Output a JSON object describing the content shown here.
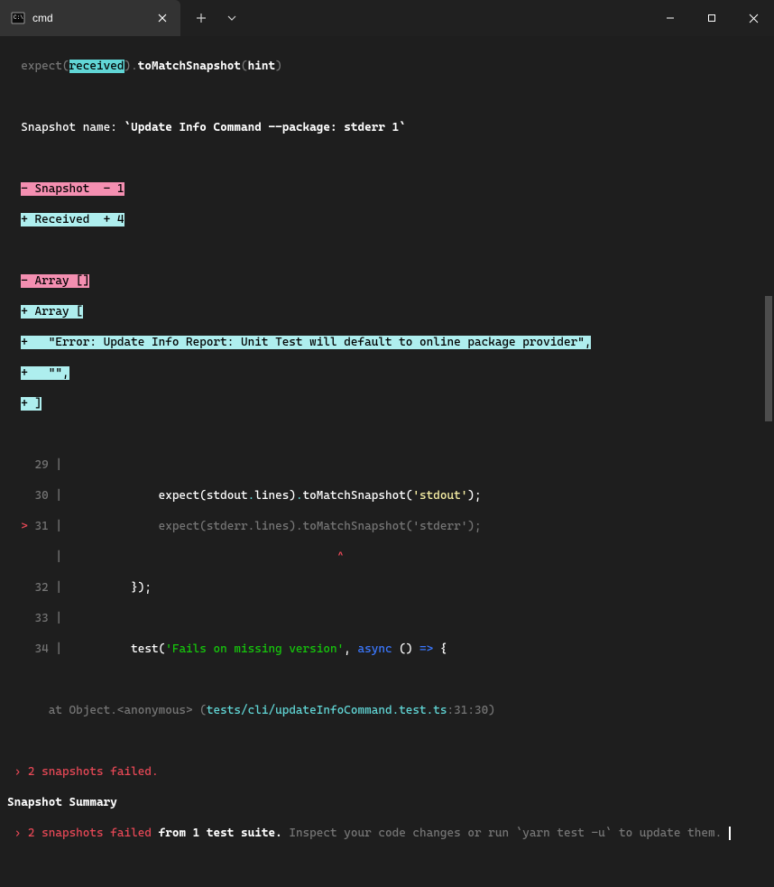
{
  "tab": {
    "label": "cmd"
  },
  "term": {
    "l1_a": "  expect(",
    "l1_b": "received",
    "l1_c": ").",
    "l1_d": "toMatchSnapshot",
    "l1_e": "(",
    "l1_f": "hint",
    "l1_g": ")",
    "l3_a": "  Snapshot name: ",
    "l3_b": "`Update Info Command --package: stderr 1`",
    "l5_a": "  ",
    "l5_b": "- Snapshot  - 1",
    "l6_a": "  ",
    "l6_b": "+ Received  + 4",
    "l8_a": "  ",
    "l8_b": "- Array []",
    "l9_a": "  ",
    "l9_b": "+ Array [",
    "l10_a": "  ",
    "l10_b": "+   \"Error: Update Info Report: Unit Test will default to online package provider\",",
    "l11_a": "  ",
    "l11_b": "+   \"\",",
    "l12_a": "  ",
    "l12_b": "+ ]",
    "ln29": "29",
    "ln30": "30",
    "ln31": "31",
    "ln32": "32",
    "ln33": "33",
    "ln34": "34",
    "gutter_marker": ">",
    "pipe": " |",
    "indent14": "              ",
    "l30_a": "expect(stdout",
    "l30_b": ".",
    "l30_c": "lines)",
    "l30_d": ".",
    "l30_e": "toMatchSnapshot(",
    "l30_f": "'stdout'",
    "l30_g": ");",
    "l31_a": "expect(stderr",
    "l31_b": ".",
    "l31_c": "lines)",
    "l31_d": ".",
    "l31_e": "toMatchSnapshot(",
    "l31_f": "'stderr'",
    "l31_g": ");",
    "caret_line": "                          ",
    "caret": "^",
    "l32_body": "          });",
    "l34_a": "          test(",
    "l34_b": "'Fails on missing version'",
    "l34_c": ", ",
    "l34_d": "async",
    "l34_e": " () ",
    "l34_f": "=>",
    "l34_g": " {",
    "stack_a": "      at Object.<anonymous> (",
    "stack_b": "tests/cli/updateInfoCommand.test.ts",
    "stack_c": ":31:30)",
    "fail1_a": " › ",
    "fail1_b": "2 snapshots failed.",
    "summary": "Snapshot Summary",
    "fail2_a": " › ",
    "fail2_b": "2 snapshots failed",
    "fail2_c": " from 1 test suite.",
    "fail2_d": " Inspect your code changes or run `yarn test -u` to update them."
  }
}
